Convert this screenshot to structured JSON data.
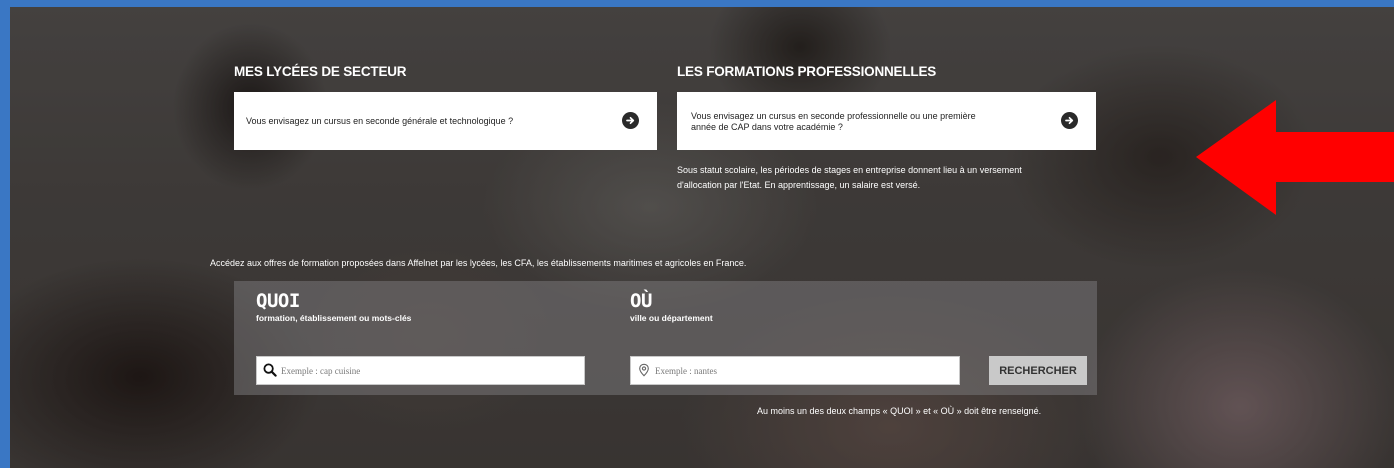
{
  "secteur": {
    "heading": "MES LYCÉES DE SECTEUR",
    "card_text": "Vous envisagez un cursus en seconde générale et technologique ?",
    "icon": "arrow-right-circle-icon"
  },
  "formations": {
    "heading": "LES FORMATIONS PROFESSIONNELLES",
    "card_text_line1": "Vous envisagez un cursus en seconde professionnelle ou une première",
    "card_text_line2": "année de CAP dans votre académie ?",
    "icon": "arrow-right-circle-icon",
    "note_line1": "Sous statut scolaire, les périodes de stages en entreprise donnent lieu à un versement",
    "note_line2": "d'allocation par l'Etat. En apprentissage, un salaire est versé."
  },
  "search": {
    "intro": "Accédez aux offres de formation proposées dans Affelnet par les lycées, les CFA, les établissements maritimes et agricoles en France.",
    "quoi": {
      "title": "QUOI",
      "subtitle": "formation, établissement ou mots-clés",
      "placeholder": "Exemple : cap cuisine",
      "icon": "search-icon"
    },
    "ou": {
      "title": "OÙ",
      "subtitle": "ville ou département",
      "placeholder": "Exemple : nantes",
      "icon": "location-pin-icon"
    },
    "button_label": "RECHERCHER",
    "requirement": "Au moins un des deux champs « QUOI » et « OÙ » doit être renseigné."
  },
  "annotation": {
    "icon": "red-arrow-left-icon",
    "color": "#ff0000"
  }
}
